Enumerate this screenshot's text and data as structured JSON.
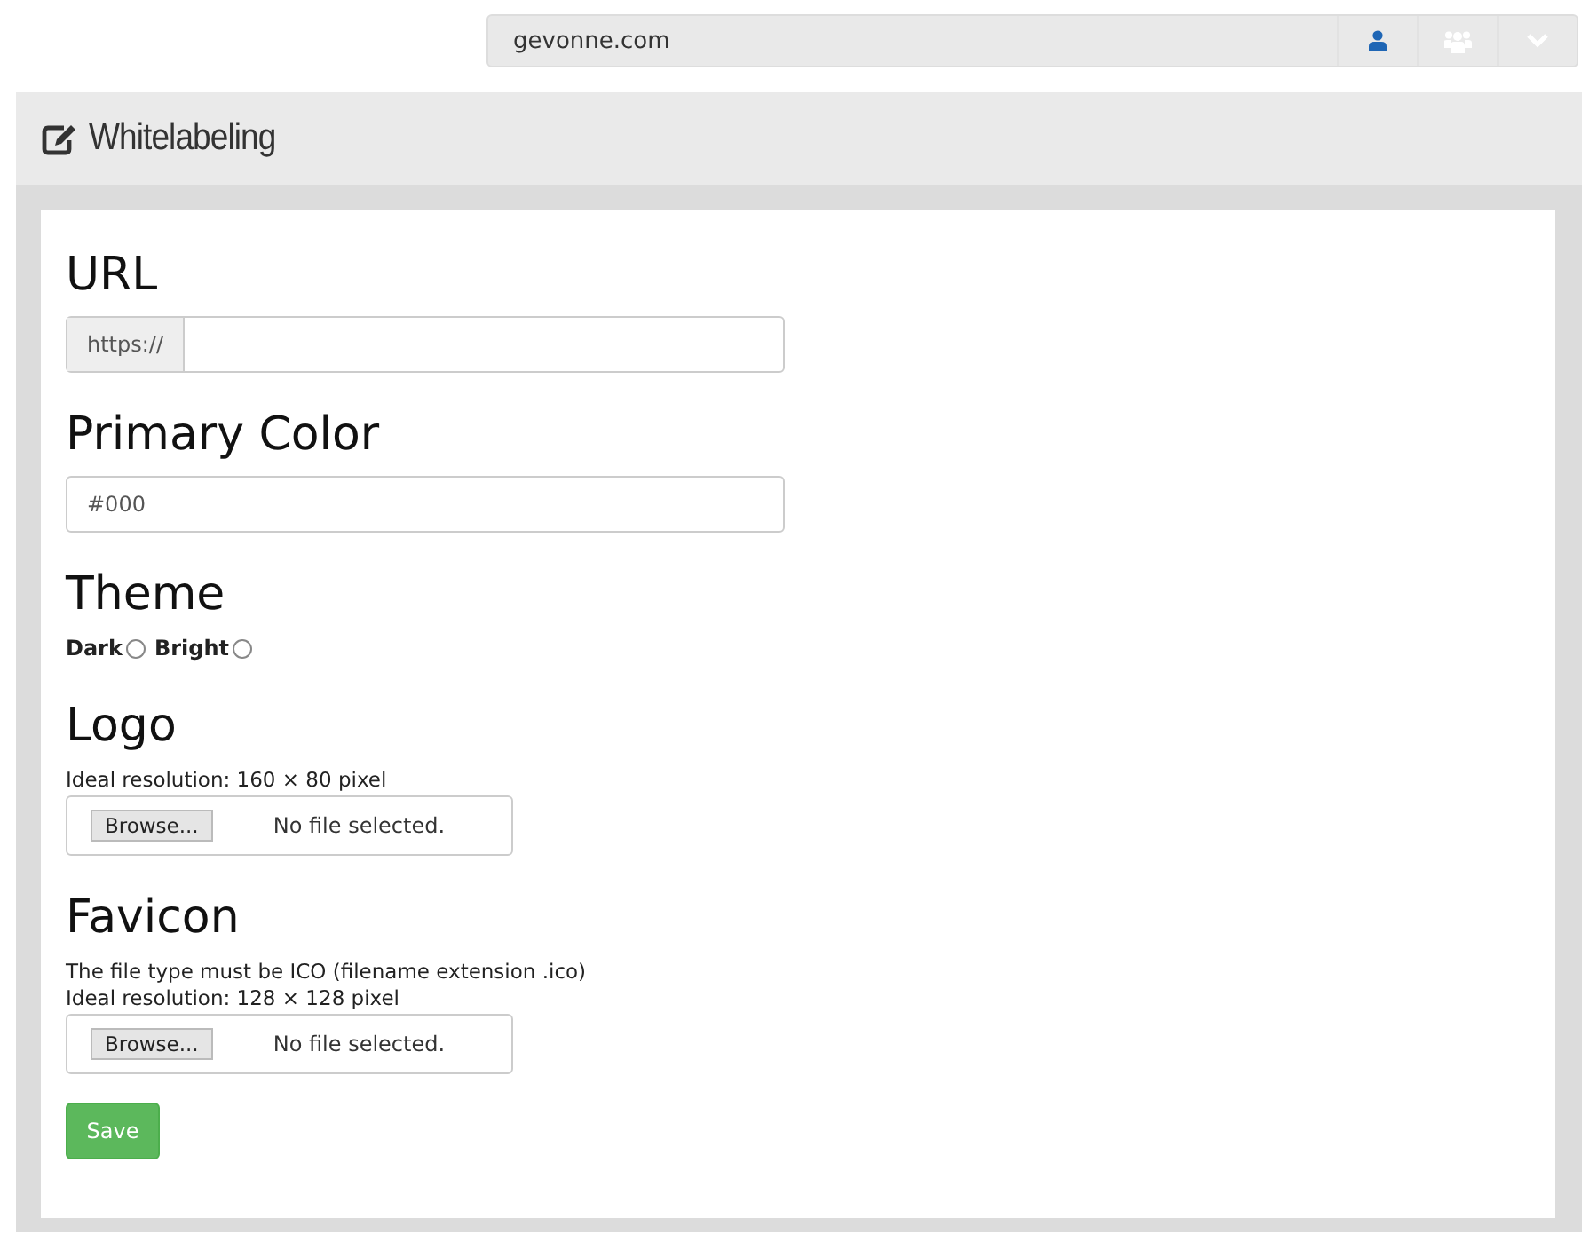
{
  "top_bar": {
    "domain": "gevonne.com"
  },
  "panel": {
    "title": "Whitelabeling"
  },
  "url": {
    "heading": "URL",
    "prefix": "https://"
  },
  "primary_color": {
    "heading": "Primary Color",
    "placeholder": "#000"
  },
  "theme": {
    "heading": "Theme",
    "options": [
      {
        "label": "Dark",
        "selected": false
      },
      {
        "label": "Bright",
        "selected": false
      }
    ]
  },
  "logo": {
    "heading": "Logo",
    "notes": [
      "Ideal resolution: 160 × 80 pixel"
    ],
    "browse": "Browse...",
    "status": "No file selected."
  },
  "favicon": {
    "heading": "Favicon",
    "notes": [
      "The file type must be ICO (filename extension .ico)",
      "Ideal resolution: 128 × 128 pixel"
    ],
    "browse": "Browse...",
    "status": "No file selected."
  },
  "save": "Save"
}
